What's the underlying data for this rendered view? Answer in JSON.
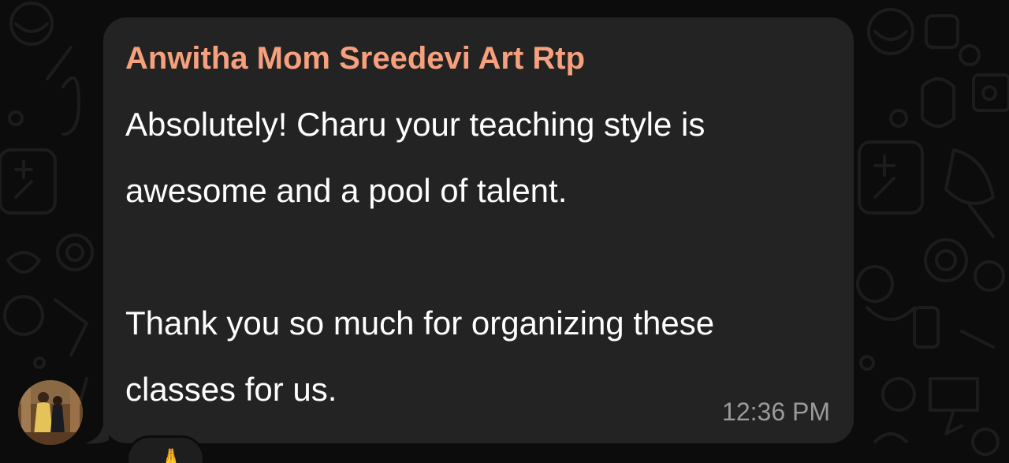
{
  "message": {
    "sender_name": "Anwitha Mom Sreedevi Art Rtp",
    "text": "Absolutely! Charu your teaching style is\nawesome and a pool of talent.\n\nThank you so much for organizing these\nclasses for us.",
    "timestamp": "12:36 PM",
    "reaction": "🙏"
  },
  "colors": {
    "sender_name": "#f6a07e",
    "bubble": "#232323",
    "background": "#0c0c0c",
    "timestamp": "#9a9a9a"
  },
  "icons": [
    "sender-avatar",
    "reaction-emoji"
  ]
}
